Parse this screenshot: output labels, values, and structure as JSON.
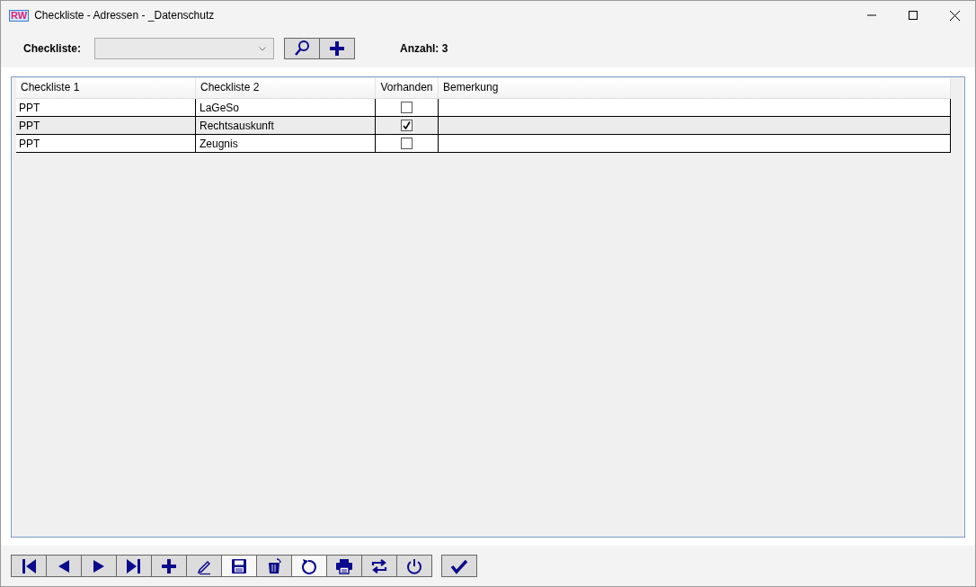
{
  "window": {
    "title": "Checkliste - Adressen - _Datenschutz",
    "logo": "RW"
  },
  "filter": {
    "label": "Checkliste:",
    "count": "Anzahl: 3"
  },
  "filter_buttons": [
    {
      "kind": "search"
    },
    {
      "kind": "add"
    }
  ],
  "table": {
    "columns": [
      "Checkliste 1",
      "Checkliste 2",
      "Vorhanden",
      "Bemerkung"
    ],
    "rows": [
      {
        "col1": "PPT",
        "col2": "LaGeSo",
        "checked": false,
        "remark": ""
      },
      {
        "col1": "PPT",
        "col2": "Rechtsauskunft",
        "checked": true,
        "remark": ""
      },
      {
        "col1": "PPT",
        "col2": "Zeugnis",
        "checked": false,
        "remark": ""
      }
    ]
  },
  "toolbar": [
    {
      "kind": "first",
      "highlighted": false
    },
    {
      "kind": "prev",
      "highlighted": false
    },
    {
      "kind": "next",
      "highlighted": false
    },
    {
      "kind": "last",
      "highlighted": false
    },
    {
      "kind": "add",
      "highlighted": false
    },
    {
      "kind": "edit",
      "highlighted": false
    },
    {
      "kind": "save",
      "highlighted": true
    },
    {
      "kind": "delete",
      "highlighted": false
    },
    {
      "kind": "undo",
      "highlighted": true
    },
    {
      "kind": "print",
      "highlighted": false
    },
    {
      "kind": "swap",
      "highlighted": false
    },
    {
      "kind": "power",
      "highlighted": false
    }
  ],
  "confirm": {
    "kind": "check"
  }
}
